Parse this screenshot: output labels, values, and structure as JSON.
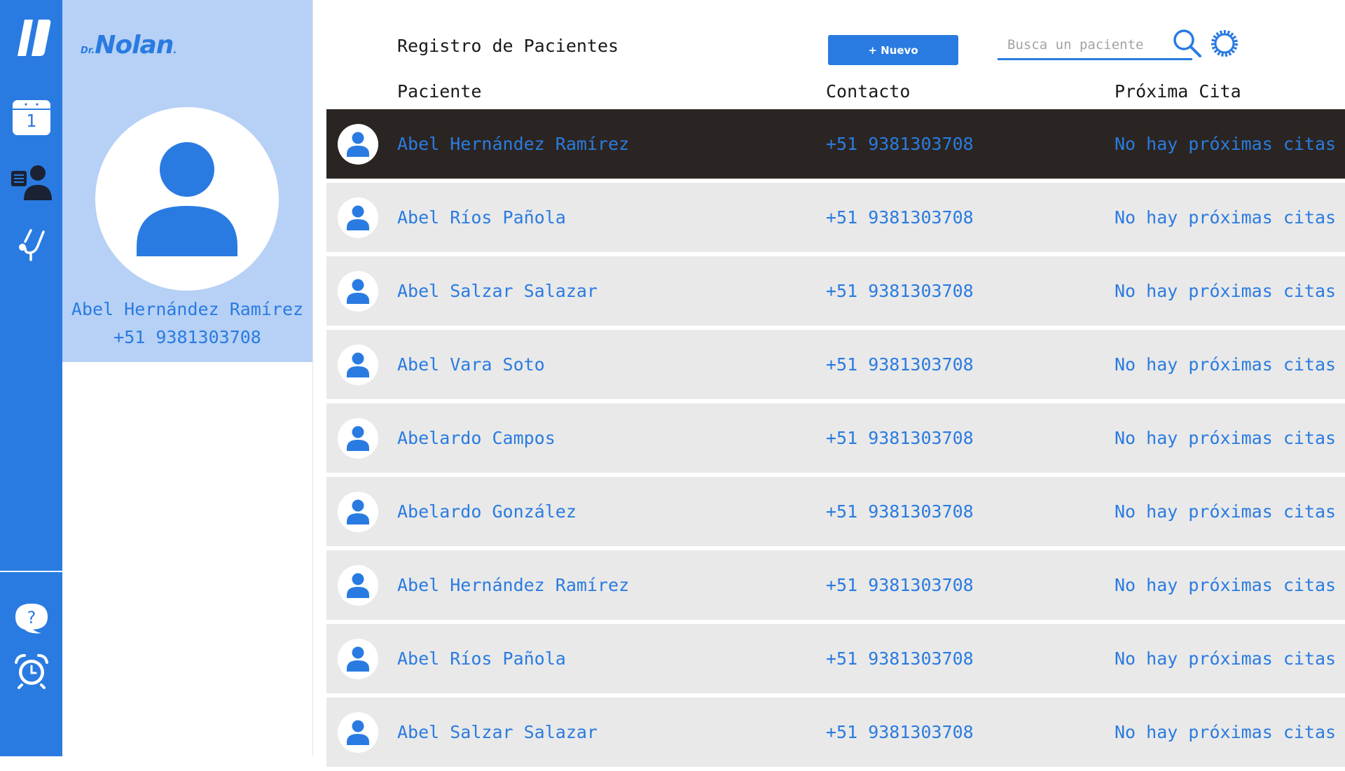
{
  "colors": {
    "accent": "#2a7be1",
    "panel": "#b6d1f5",
    "row": "#e9e9e9",
    "selected_row": "#2a2522"
  },
  "rail": {
    "logo_icon": "app-logo-icon",
    "calendar_day": "1",
    "items": [
      "calendar-icon",
      "patients-icon",
      "stethoscope-icon"
    ],
    "bottom_items": [
      "help-chat-icon",
      "alarm-clock-icon"
    ]
  },
  "brand": {
    "prefix": "Dr.",
    "name": "Nolan",
    "suffix": "."
  },
  "profile": {
    "name": "Abel Hernández Ramírez",
    "phone": "+51 9381303708"
  },
  "header": {
    "title": "Registro de Pacientes",
    "new_button": "+ Nuevo",
    "search_placeholder": "Busca un paciente"
  },
  "table": {
    "columns": [
      "Paciente",
      "Contacto",
      "Próxima Cita"
    ],
    "rows": [
      {
        "name": "Abel Hernández Ramírez",
        "contact": "+51 9381303708",
        "next": "No hay próximas citas",
        "selected": true
      },
      {
        "name": "Abel Ríos Pañola",
        "contact": "+51 9381303708",
        "next": "No hay próximas citas",
        "selected": false
      },
      {
        "name": "Abel Salzar Salazar",
        "contact": "+51 9381303708",
        "next": "No hay próximas citas",
        "selected": false
      },
      {
        "name": "Abel Vara Soto",
        "contact": "+51 9381303708",
        "next": "No hay próximas citas",
        "selected": false
      },
      {
        "name": "Abelardo Campos",
        "contact": "+51 9381303708",
        "next": "No hay próximas citas",
        "selected": false
      },
      {
        "name": "Abelardo González",
        "contact": "+51 9381303708",
        "next": "No hay próximas citas",
        "selected": false
      },
      {
        "name": "Abel Hernández Ramírez",
        "contact": "+51 9381303708",
        "next": "No hay próximas citas",
        "selected": false
      },
      {
        "name": "Abel Ríos Pañola",
        "contact": "+51 9381303708",
        "next": "No hay próximas citas",
        "selected": false
      },
      {
        "name": "Abel Salzar Salazar",
        "contact": "+51 9381303708",
        "next": "No hay próximas citas",
        "selected": false
      }
    ]
  }
}
